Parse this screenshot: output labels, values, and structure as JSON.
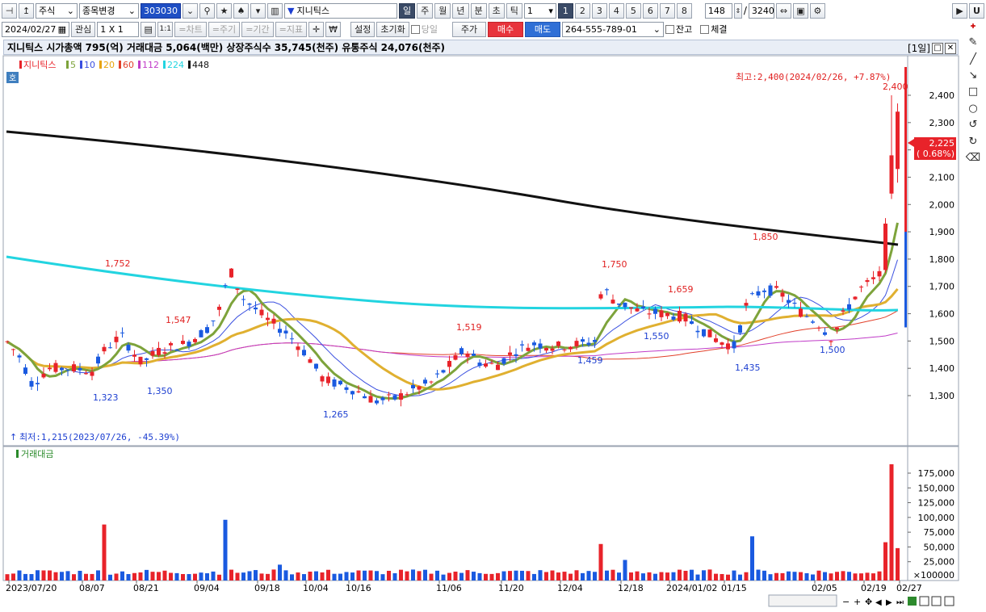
{
  "toolbar1": {
    "market_select": "주식",
    "change_select": "종목변경",
    "code": "303030",
    "stock_name": "지니틱스",
    "period_tabs": [
      "일",
      "주",
      "월",
      "년",
      "분",
      "초",
      "틱"
    ],
    "period_value": "1",
    "page_tabs": [
      "1",
      "2",
      "3",
      "4",
      "5",
      "6",
      "7",
      "8"
    ],
    "count_value": "148",
    "total_value": "3240",
    "u_label": "U"
  },
  "toolbar2": {
    "date": "2024/02/27",
    "watch_label": "관심",
    "grid_label": "1 X 1",
    "chart_btn": "=차트",
    "cycle_btn": "=주기",
    "period_btn": "=기간",
    "index_btn": "=지표",
    "setup_btn": "설정",
    "reset_btn": "초기화",
    "today_label": "당일",
    "price_btn": "주가",
    "buy_btn": "매수",
    "sell_btn": "매도",
    "account": "264-555-789-01",
    "balance_label": "잔고",
    "trade_label": "체결"
  },
  "infobar": {
    "text": "지니틱스  시가총액 795(억)  거래대금 5,064(백만)  상장주식수 35,745(천주)  유통주식 24,076(천주)",
    "period_label": "[1일]"
  },
  "price_panel": {
    "ho_label": "호",
    "legend_name": "지니틱스",
    "ma_legend": [
      {
        "label": "5",
        "color": "#7da33b"
      },
      {
        "label": "10",
        "color": "#3a4fe0"
      },
      {
        "label": "20",
        "color": "#e8a40c"
      },
      {
        "label": "60",
        "color": "#e2402a"
      },
      {
        "label": "112",
        "color": "#c03bc8"
      },
      {
        "label": "224",
        "color": "#22d4e0"
      },
      {
        "label": "448",
        "color": "#111111"
      }
    ],
    "high_note": "최고:2,400(2024/02/26, +7.87%)",
    "low_note": "최저:1,215(2023/07/26, -45.39%)",
    "current_price": "2,225",
    "current_change": "( 0.68%)",
    "y_ticks": [
      "2,400",
      "2,300",
      "2,200",
      "2,100",
      "2,000",
      "1,900",
      "1,800",
      "1,700",
      "1,600",
      "1,500",
      "1,400",
      "1,300"
    ],
    "annotations": [
      {
        "text": "1,752",
        "color": "#e02020"
      },
      {
        "text": "1,547",
        "color": "#e02020"
      },
      {
        "text": "1,323",
        "color": "#1d3fd1"
      },
      {
        "text": "1,350",
        "color": "#1d3fd1"
      },
      {
        "text": "1,265",
        "color": "#1d3fd1"
      },
      {
        "text": "1,519",
        "color": "#e02020"
      },
      {
        "text": "1,459",
        "color": "#1d3fd1"
      },
      {
        "text": "1,750",
        "color": "#e02020"
      },
      {
        "text": "1,659",
        "color": "#e02020"
      },
      {
        "text": "1,550",
        "color": "#1d3fd1"
      },
      {
        "text": "1,850",
        "color": "#e02020"
      },
      {
        "text": "1,435",
        "color": "#1d3fd1"
      },
      {
        "text": "1,500",
        "color": "#1d3fd1"
      },
      {
        "text": "2,400",
        "color": "#e02020"
      }
    ]
  },
  "volume_panel": {
    "legend": "거래대금",
    "y_ticks": [
      "175,000",
      "150,000",
      "125,000",
      "100,000",
      "75,000",
      "50,000",
      "25,000"
    ],
    "unit": "×100000"
  },
  "x_axis": [
    "2023/07/20",
    "08/07",
    "08/21",
    "09/04",
    "09/18",
    "10/04",
    "10/16",
    "11/06",
    "11/20",
    "12/04",
    "12/18",
    "2024/01/02",
    "01/15",
    "02/05",
    "02/19",
    "02/27"
  ],
  "colors": {
    "up": "#e8232a",
    "down": "#1a5ae0",
    "bg_panel": "#ffffff",
    "axis_bg": "#ffffff"
  }
}
